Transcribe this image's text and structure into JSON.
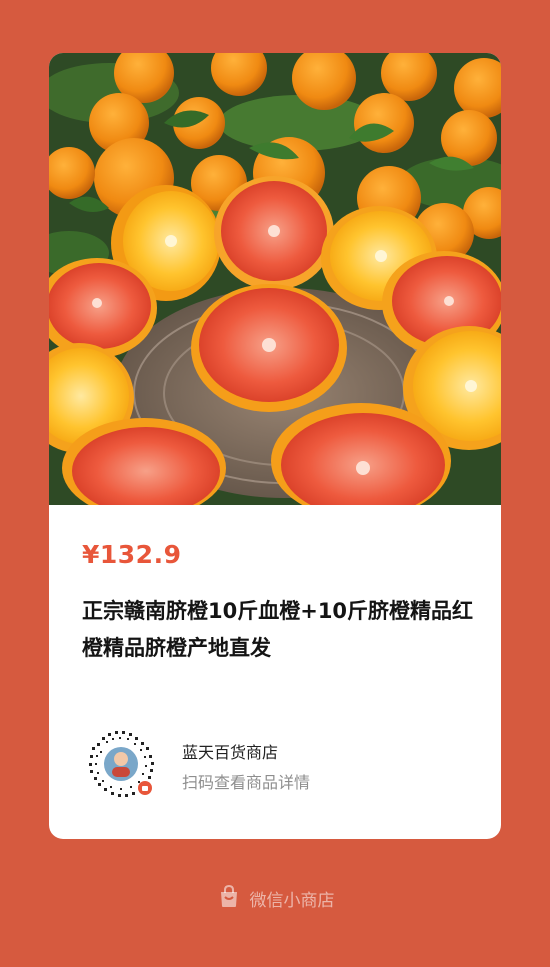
{
  "product": {
    "price": "¥132.9",
    "title": "正宗赣南脐橙10斤血橙+10斤脐橙精品红橙精品脐橙产地直发",
    "image_icon": "orange-product-photo"
  },
  "shop": {
    "name": "蓝天百货商店",
    "hint": "扫码查看商品详情",
    "qr_icon": "qr-code-icon"
  },
  "footer": {
    "label": "微信小商店",
    "icon": "shop-bag-icon"
  },
  "colors": {
    "background": "#d65a3f",
    "price": "#e8563a",
    "card": "#ffffff"
  }
}
